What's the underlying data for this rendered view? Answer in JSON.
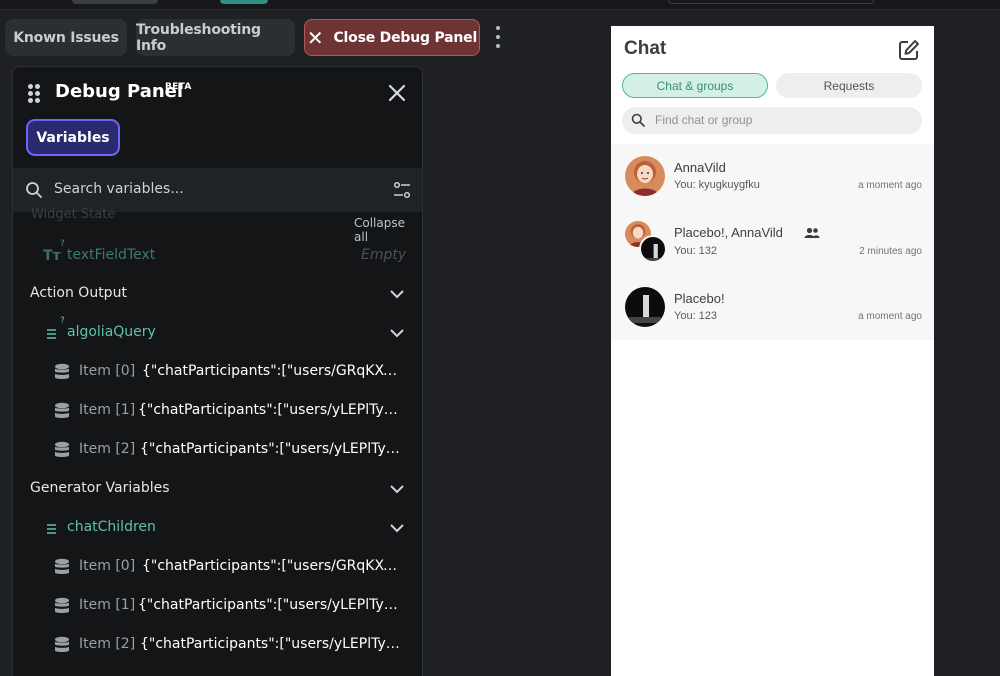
{
  "toolbar": {
    "known_issues": "Known Issues",
    "troubleshooting": "Troubleshooting Info",
    "close_debug": "Close Debug Panel",
    "close_color": "#6e3434"
  },
  "panel": {
    "title": "Debug Panel",
    "beta": "BETA",
    "tab_variables": "Variables",
    "search_placeholder": "Search variables...",
    "collapse_all": "Collapse all",
    "faded_section": "Widget State",
    "text_field": {
      "icon_text": "Tт",
      "name": "textFieldText",
      "value": "Empty"
    },
    "action_output": {
      "label": "Action Output",
      "query": {
        "name": "algoliaQuery",
        "items": [
          {
            "label": "Item [0]",
            "value": "{\"chatParticipants\":[\"users/GRqKXCDe..."
          },
          {
            "label": "Item [1]",
            "value": "{\"chatParticipants\":[\"users/yLEPlTyBZX..."
          },
          {
            "label": "Item [2]",
            "value": "{\"chatParticipants\":[\"users/yLEPlTyBZX..."
          }
        ]
      }
    },
    "generator": {
      "label": "Generator Variables",
      "children": {
        "name": "chatChildren",
        "items": [
          {
            "label": "Item [0]",
            "value": "{\"chatParticipants\":[\"users/GRqKXCDe..."
          },
          {
            "label": "Item [1]",
            "value": "{\"chatParticipants\":[\"users/yLEPlTyBZX..."
          },
          {
            "label": "Item [2]",
            "value": "{\"chatParticipants\":[\"users/yLEPlTyBZX..."
          }
        ]
      }
    }
  },
  "chat": {
    "title": "Chat",
    "tab_active": "Chat & groups",
    "tab_inactive": "Requests",
    "search_placeholder": "Find chat or group",
    "accent": "#4fb896",
    "items": [
      {
        "name": "AnnaVild",
        "message": "You: kyugkuygfku",
        "time": "a moment ago"
      },
      {
        "name": "Placebo!, AnnaVild",
        "message": "You: 132",
        "time": "2 minutes ago"
      },
      {
        "name": "Placebo!",
        "message": "You: 123",
        "time": "a moment ago"
      }
    ]
  }
}
